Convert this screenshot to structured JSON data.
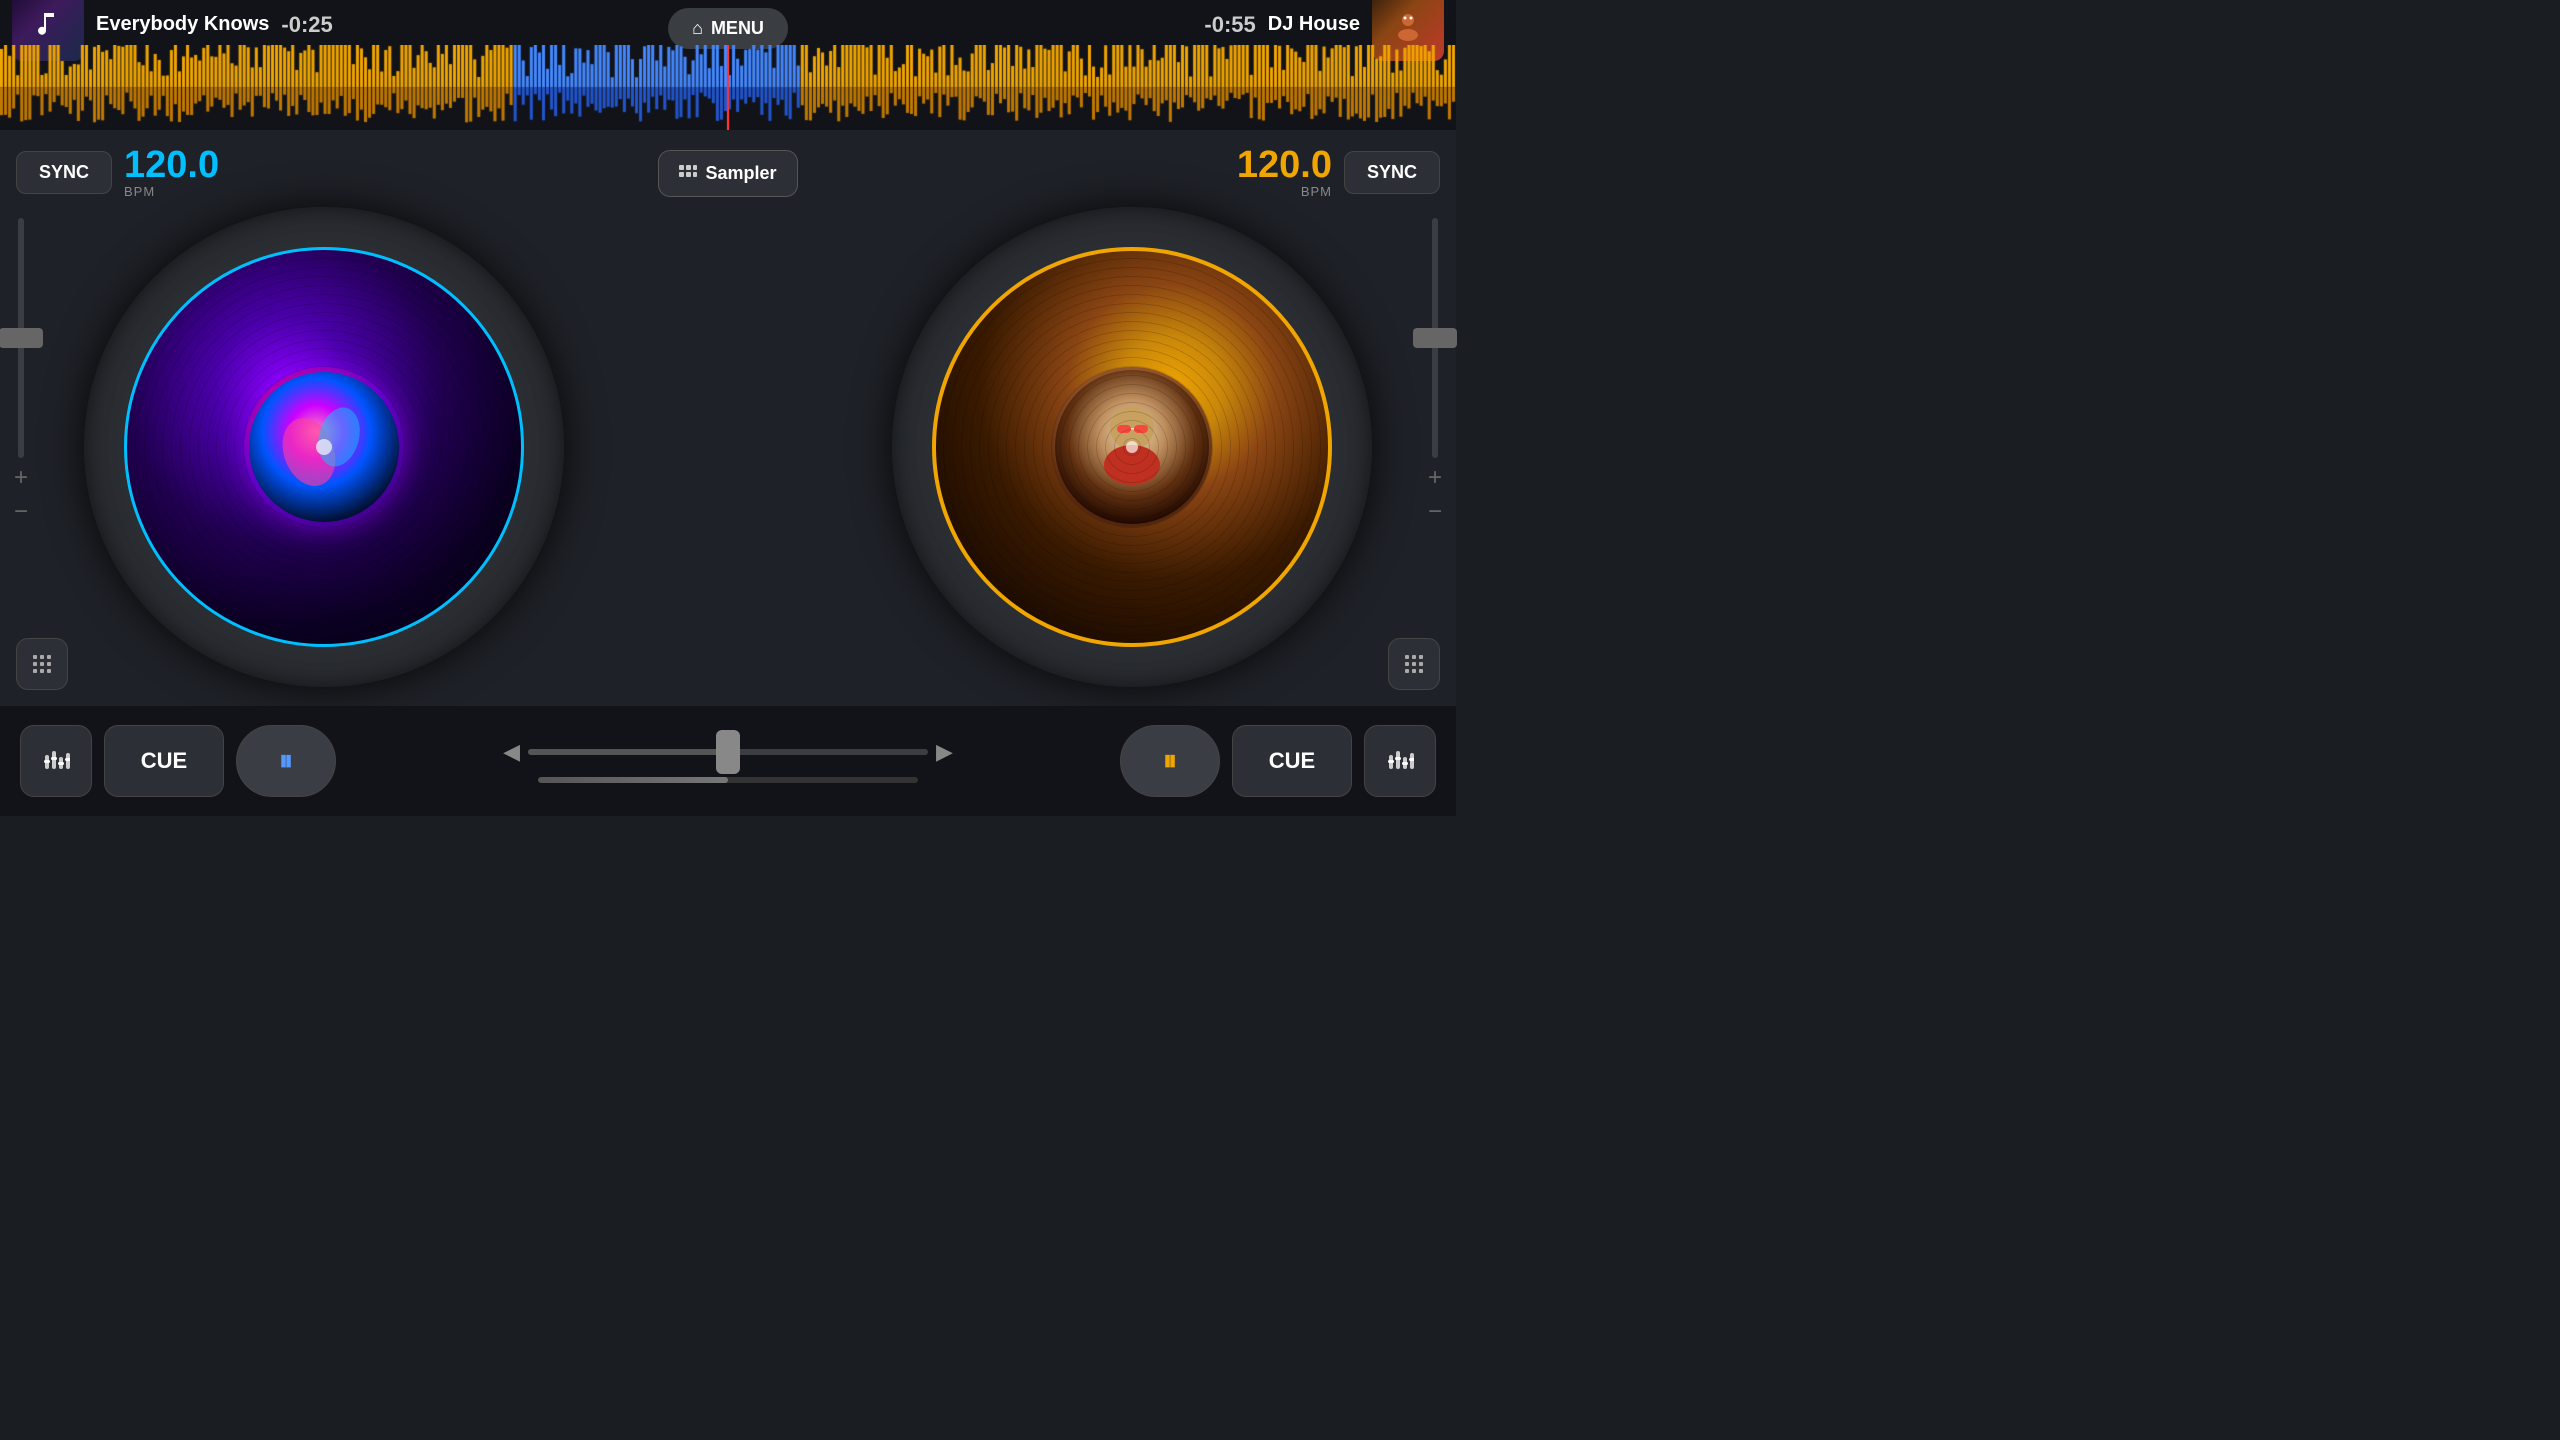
{
  "topBar": {
    "leftTrack": {
      "name": "Everybody Knows",
      "timer": "-0:25",
      "artAlt": "music note"
    },
    "rightTrack": {
      "name": "DJ House",
      "timer": "-0:55",
      "artAlt": "dj portrait"
    },
    "menuLabel": "MENU"
  },
  "leftDeck": {
    "syncLabel": "SYNC",
    "bpm": "120.0",
    "bpmUnit": "BPM",
    "plusLabel": "+",
    "minusLabel": "−",
    "cueLabel": "CUE",
    "pauseSymbol": "⏸"
  },
  "rightDeck": {
    "syncLabel": "SYNC",
    "bpm": "120.0",
    "bpmUnit": "BPM",
    "plusLabel": "+",
    "minusLabel": "−",
    "cueLabel": "CUE",
    "pauseSymbol": "⏸"
  },
  "center": {
    "samplerLabel": "Sampler",
    "samplerIcon": "grid"
  },
  "bottomControls": {
    "leftEqIcon": "equalizer",
    "rightEqIcon": "equalizer",
    "leftArrow": "◀",
    "rightArrow": "▶"
  }
}
